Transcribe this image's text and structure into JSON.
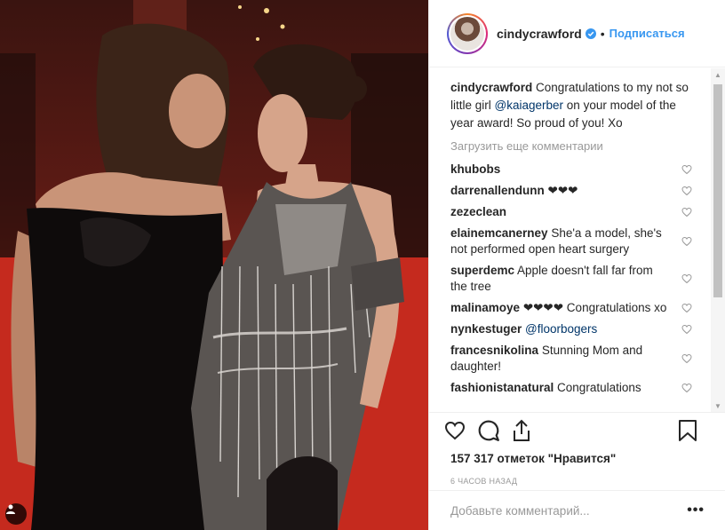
{
  "post": {
    "author": "cindycrawford",
    "verified": true,
    "separator": "•",
    "follow_label": "Подписаться"
  },
  "caption": {
    "author": "cindycrawford",
    "text_before": "Congratulations to my not so little girl",
    "mention": "@kaiagerber",
    "text_after": "on your model of the year award! So proud of you! Xo"
  },
  "load_more_label": "Загрузить еще комментарии",
  "comments": [
    {
      "user": "khubobs",
      "text": "",
      "mention": ""
    },
    {
      "user": "darrenallendunn",
      "text": "❤❤❤",
      "mention": ""
    },
    {
      "user": "zezeclean",
      "text": "",
      "mention": ""
    },
    {
      "user": "elainemcanerney",
      "text": "She'a a model, she's not performed open heart surgery",
      "mention": ""
    },
    {
      "user": "superdemc",
      "text": "Apple doesn't fall far from the tree",
      "mention": ""
    },
    {
      "user": "malinamoye",
      "text": "❤❤❤❤ Congratulations xo",
      "mention": ""
    },
    {
      "user": "nynkestuger",
      "text": "",
      "mention": "@floorbogers"
    },
    {
      "user": "francesnikolina",
      "text": "Stunning Mom and daughter!",
      "mention": ""
    },
    {
      "user": "fashionistanatural",
      "text": "Congratulations",
      "mention": ""
    }
  ],
  "likes_label": "157 317 отметок \"Нравится\"",
  "time_label": "6 ЧАСОВ НАЗАД",
  "add_comment_placeholder": "Добавьте комментарий...",
  "more_label": "•••",
  "icons": {
    "like": "heart-icon",
    "comment": "comment-icon",
    "share": "share-icon",
    "save": "bookmark-icon",
    "tag": "user-tag-icon"
  },
  "colors": {
    "link": "#3897f0",
    "mention": "#003569",
    "muted": "#999999",
    "text": "#262626"
  }
}
